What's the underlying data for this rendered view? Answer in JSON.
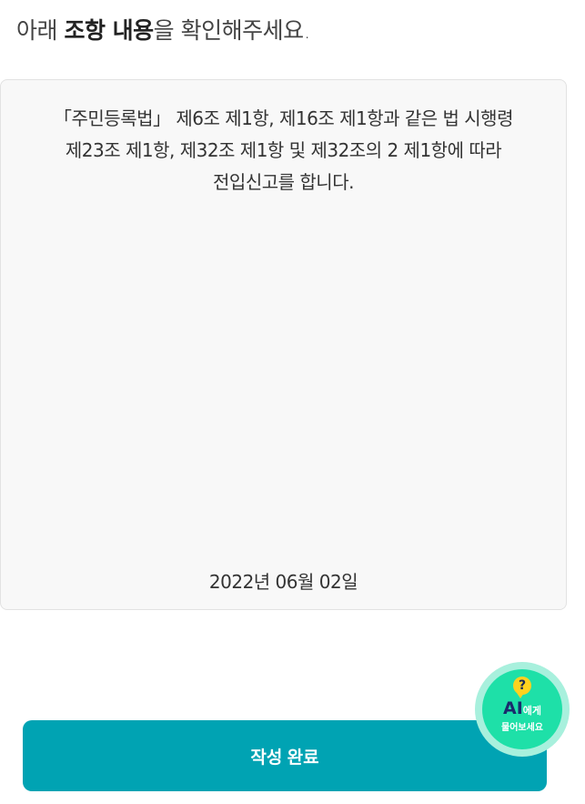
{
  "heading": {
    "prefix": "아래 ",
    "emphasis": "조항 내용",
    "suffix": "을 확인해주세요."
  },
  "clause": {
    "text": "「주민등록법」 제6조 제1항, 제16조 제1항과 같은 법 시행령\n제23조 제1항, 제32조 제1항 및 제32조의 2 제1항에 따라\n전입신고를 합니다.",
    "date": "2022년 06월 02일"
  },
  "submit": {
    "label": "작성 완료"
  },
  "ai_fab": {
    "icon": "question-bubble-icon",
    "icon_glyph": "?",
    "ai_label": "AI",
    "ai_suffix": "에게",
    "line2": "물어보세요"
  },
  "colors": {
    "primary": "#00a3b3",
    "fab_outer": "#a8f0dd",
    "fab_inner": "#1ee0a8",
    "fab_question": "#ffd21f"
  }
}
